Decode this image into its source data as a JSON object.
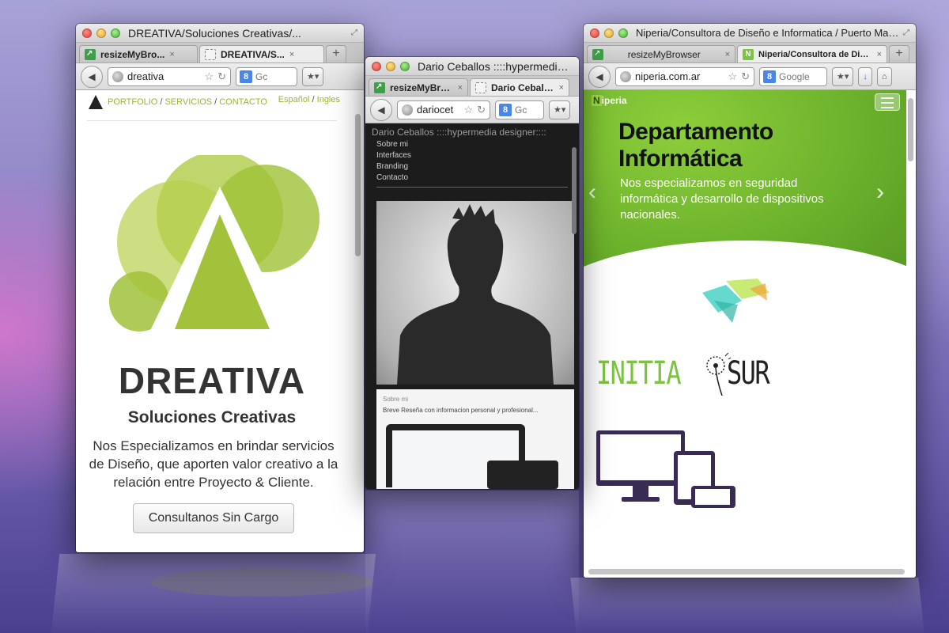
{
  "window_left": {
    "title": "DREATIVA/Soluciones Creativas/...",
    "tabs": [
      {
        "label": "resizeMyBro...",
        "icon": "resize-icon"
      },
      {
        "label": "DREATIVA/S...",
        "icon": "blank-page-icon"
      }
    ],
    "url": "dreativa",
    "search_placeholder": "Gc",
    "site": {
      "nav": {
        "portfolio": "PORTFOLIO",
        "servicios": "SERVICIOS",
        "contacto": "CONTACTO",
        "sep": "/"
      },
      "lang": {
        "es": "Español",
        "en": "Ingles",
        "sep": "/"
      },
      "brand": "DREATIVA",
      "tagline": "Soluciones Creativas",
      "description": "Nos Especializamos en brindar servicios de Diseño, que aporten valor creativo a la relación entre Proyecto & Cliente.",
      "cta": "Consultanos Sin Cargo",
      "accent_color": "#9ab52a"
    }
  },
  "window_middle": {
    "title": "Dario Ceballos ::::hypermedia de...",
    "tabs": [
      {
        "label": "resizeMyBro...",
        "icon": "resize-icon"
      },
      {
        "label": "Dario Ceball...",
        "icon": "blank-page-icon"
      }
    ],
    "url": "dariocet",
    "search_placeholder": "Gc",
    "site": {
      "header": "Dario Ceballos ::::hypermedia designer::::",
      "menu": [
        "Sobre mi",
        "Interfaces",
        "Branding",
        "Contacto"
      ],
      "about_label": "Sobre mi",
      "about_text": "Breve Reseña con informacion personal y profesional..."
    }
  },
  "window_right": {
    "title": "Niperia/Consultora de Diseño e Informatica / Puerto Madr...",
    "tabs": [
      {
        "label": "resizeMyBrowser",
        "icon": "resize-icon"
      },
      {
        "label": "Niperia/Consultora de Dis...",
        "icon": "niperia-icon"
      }
    ],
    "url": "niperia.com.ar",
    "search_placeholder": "Google",
    "site": {
      "brand_n": "N",
      "brand_rest": "iperia",
      "hero_title_1": "Departamento",
      "hero_title_2": "Informática",
      "hero_desc": "Nos especializamos en seguridad informática y desarrollo de dispositivos nacionales.",
      "partner_a": "INITIA",
      "partner_b": "SUR",
      "accent_color": "#7cc243"
    }
  },
  "common": {
    "close_glyph": "×",
    "new_tab_glyph": "+",
    "back_glyph": "◀",
    "star_glyph": "☆",
    "reload_glyph": "↻",
    "g_label": "8",
    "bookmarks_glyph": "★▾",
    "download_glyph": "↓",
    "home_glyph": "⌂",
    "dropdown_glyph": "▾",
    "prev_glyph": "‹",
    "next_glyph": "›"
  }
}
